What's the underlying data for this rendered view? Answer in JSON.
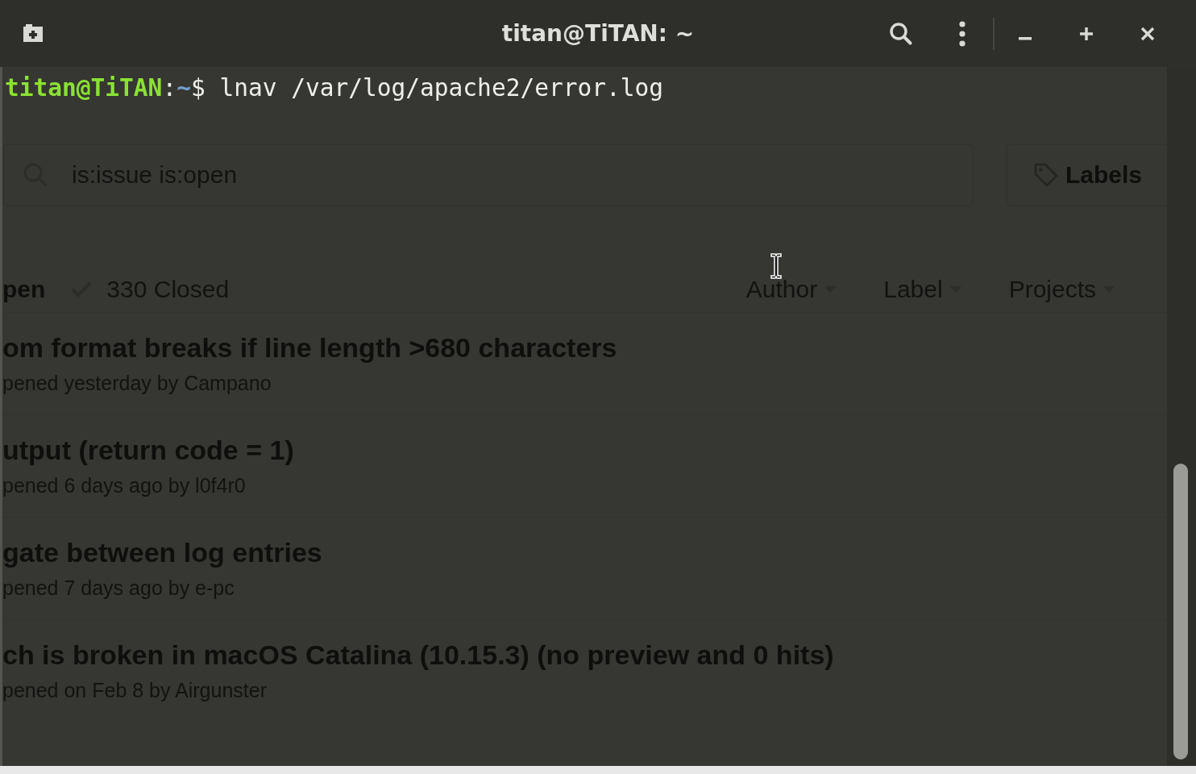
{
  "window": {
    "title": "titan@TiTAN: ~"
  },
  "terminal": {
    "lines": [
      {
        "user_host": "titan@TiTAN",
        "separator": ":",
        "path": "~",
        "prompt": "$",
        "command": "lnav /var/log/apache2/error.log"
      }
    ]
  },
  "background_page": {
    "search": {
      "value": "is:issue is:open"
    },
    "labels_button": "Labels",
    "states": [
      {
        "label": "pen",
        "kind": "open",
        "selected": true
      },
      {
        "label": "330 Closed",
        "kind": "closed",
        "selected": false
      }
    ],
    "filters": [
      "Author",
      "Label",
      "Projects"
    ],
    "issues": [
      {
        "title": "om format breaks if line length >680 characters",
        "meta": "pened yesterday by Campano"
      },
      {
        "title": "utput (return code = 1)",
        "meta": "pened 6 days ago by l0f4r0"
      },
      {
        "title": "gate between log entries",
        "meta": "pened 7 days ago by e-pc"
      },
      {
        "title": "ch is broken in macOS Catalina (10.15.3) (no preview and 0 hits)",
        "meta": "pened on Feb 8 by Airgunster"
      }
    ]
  }
}
